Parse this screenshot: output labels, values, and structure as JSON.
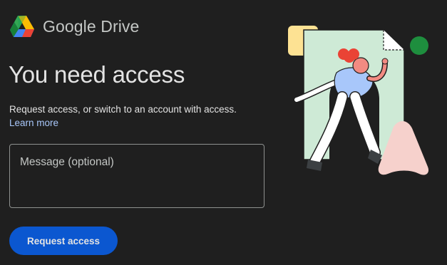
{
  "header": {
    "app_name": "Google Drive",
    "logo_icon": "google-drive-logo-icon"
  },
  "main": {
    "headline": "You need access",
    "description": "Request access, or switch to an account with access.",
    "learn_more_label": "Learn more",
    "message_placeholder": "Message (optional)",
    "message_value": "",
    "request_button_label": "Request access"
  },
  "illustration": {
    "name": "person-walking-through-document-illustration"
  },
  "colors": {
    "background": "#1f1f1f",
    "link": "#a8c7fa",
    "primary_button": "#0b57d0",
    "drive_green": "#34a853",
    "drive_yellow": "#fbbc04",
    "drive_blue": "#4285f4"
  }
}
